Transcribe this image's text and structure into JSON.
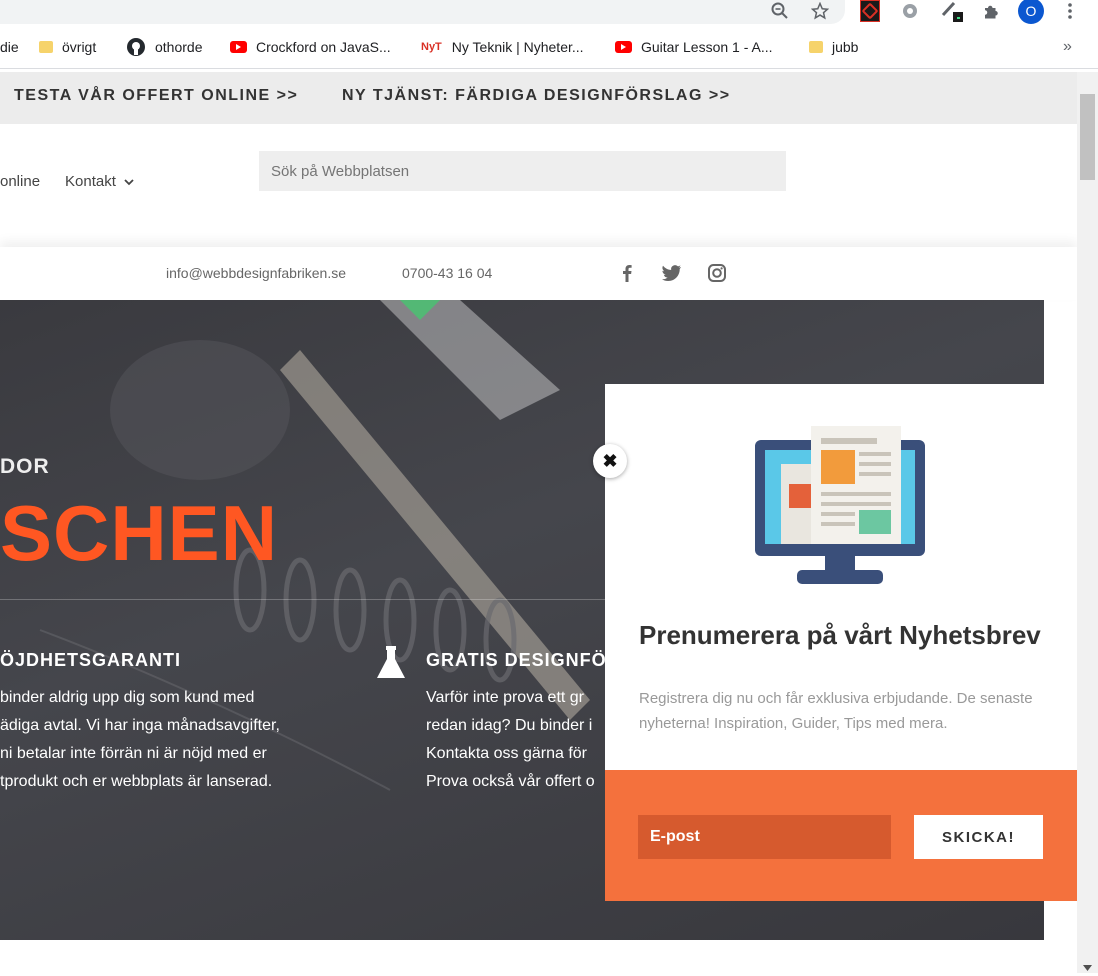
{
  "browser": {
    "bookmarks": [
      {
        "label": "die",
        "icon": "none"
      },
      {
        "label": "övrigt",
        "icon": "folder-icon"
      },
      {
        "label": "othorde",
        "icon": "github-icon"
      },
      {
        "label": "Crockford on JavaS...",
        "icon": "youtube-icon"
      },
      {
        "label": "Ny Teknik | Nyheter...",
        "icon": "nyteknik-icon"
      },
      {
        "label": "Guitar Lesson 1 - A...",
        "icon": "youtube-icon"
      },
      {
        "label": "jubb",
        "icon": "folder-icon"
      }
    ],
    "bookmarks_overflow": "»",
    "nyteknik_badge": "NyT",
    "profile_initial": "O"
  },
  "promo_bar": {
    "link1": "TESTA VÅR OFFERT ONLINE >>",
    "link2": "NY TJÄNST: FÄRDIGA DESIGNFÖRSLAG >>"
  },
  "nav": {
    "item_online": "online",
    "item_contact": "Kontakt",
    "search_placeholder": "Sök på Webbplatsen"
  },
  "contact_bar": {
    "email": "info@webbdesignfabriken.se",
    "phone": "0700-43 16 04"
  },
  "hero": {
    "subtitle": "DOR",
    "title": "SCHEN",
    "feature1": {
      "heading": "ÖJDHETSGARANTI",
      "lines": [
        "binder aldrig upp dig som kund med",
        "ädiga avtal. Vi har inga månadsavgifter,",
        " ni betalar inte förrän ni är nöjd med er",
        "tprodukt och er webbplats är lanserad."
      ]
    },
    "feature2": {
      "heading": "GRATIS DESIGNFÖ",
      "lines": [
        "Varför inte prova ett gr",
        "redan idag? Du binder i",
        "Kontakta oss gärna för",
        "Prova också vår offert o"
      ]
    }
  },
  "popup": {
    "close_glyph": "✖",
    "title": "Prenumerera på vårt Nyhetsbrev",
    "text": "Registrera dig nu och får exklusiva erbjudande. De senaste nyheterna! Inspiration, Guider, Tips med mera.",
    "email_placeholder": "E-post",
    "submit_label": "SKICKA!"
  },
  "colors": {
    "accent_orange": "#ff5722",
    "popup_orange": "#f4713d",
    "email_field": "#d65a2e",
    "hero_bg": "#3f4045"
  }
}
